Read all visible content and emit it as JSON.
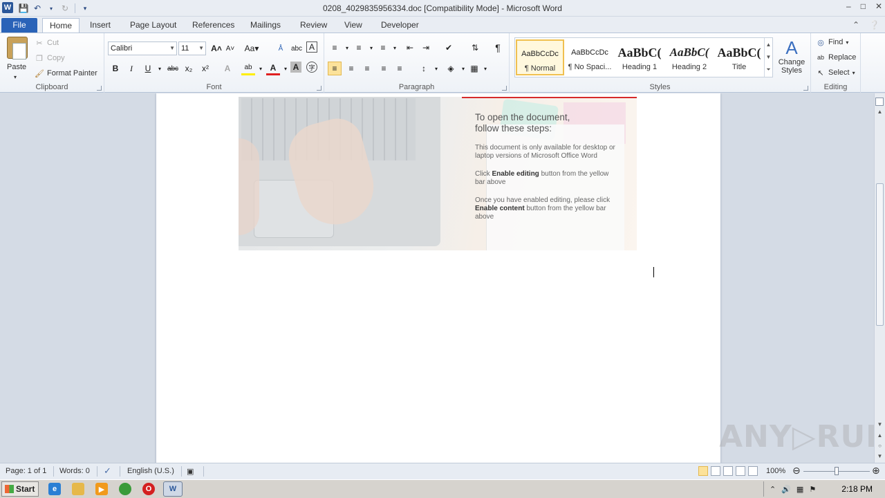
{
  "window": {
    "title": "0208_4029835956334.doc [Compatibility Mode]  -  Microsoft Word",
    "app_icon": "W",
    "controls": [
      "–",
      "□",
      "✕"
    ]
  },
  "tabs": [
    {
      "label": "File"
    },
    {
      "label": "Home"
    },
    {
      "label": "Insert"
    },
    {
      "label": "Page Layout"
    },
    {
      "label": "References"
    },
    {
      "label": "Mailings"
    },
    {
      "label": "Review"
    },
    {
      "label": "View"
    },
    {
      "label": "Developer"
    }
  ],
  "clipboard": {
    "paste": "Paste",
    "cut": "Cut",
    "copy": "Copy",
    "format_painter": "Format Painter",
    "label": "Clipboard"
  },
  "font": {
    "name": "Calibri",
    "size": "11",
    "label": "Font"
  },
  "paragraph": {
    "label": "Paragraph"
  },
  "styles": {
    "label": "Styles",
    "items": [
      {
        "preview": "AaBbCcDc",
        "name": "¶ Normal"
      },
      {
        "preview": "AaBbCcDc",
        "name": "¶ No Spaci..."
      },
      {
        "preview": "AaBbC(",
        "name": "Heading 1"
      },
      {
        "preview": "AaBbC(",
        "name": "Heading 2"
      },
      {
        "preview": "AaBbC(",
        "name": "Title"
      }
    ],
    "change_styles": "Change Styles"
  },
  "editing": {
    "find": "Find",
    "replace": "Replace",
    "select": "Select",
    "label": "Editing"
  },
  "document": {
    "banner_heading_1": "To open the document,",
    "banner_heading_2": "follow these steps:",
    "para1": "This document is only available for desktop or laptop versions of Microsoft Office Word",
    "para2_pre": "Click ",
    "para2_bold": "Enable editing",
    "para2_post": " button from the yellow bar above",
    "para3_pre": "Once you have enabled editing, please click ",
    "para3_bold": "Enable content",
    "para3_post": " button from the yellow bar above"
  },
  "statusbar": {
    "page": "Page: 1 of 1",
    "words": "Words: 0",
    "language": "English (U.S.)",
    "zoom": "100%",
    "zoom_level_percent": 100
  },
  "watermark": "ANY▷RUN",
  "taskbar": {
    "start": "Start",
    "clock": "2:18 PM"
  },
  "colors": {
    "file_tab": "#2a63b8",
    "selected_style": "#f0c050",
    "banner_line": "#d62a2a"
  }
}
